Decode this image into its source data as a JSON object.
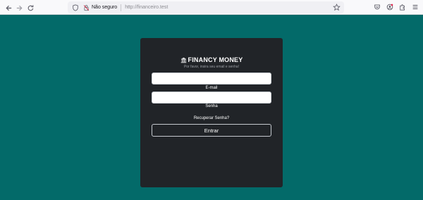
{
  "browser": {
    "security_label": "Não seguro",
    "url": "http://financeiro.test",
    "icons": [
      "back-icon",
      "forward-icon",
      "reload-icon",
      "shield-icon",
      "lock-insecure-icon",
      "star-icon",
      "pocket-icon",
      "account-icon",
      "extensions-icon",
      "menu-icon"
    ]
  },
  "login": {
    "brand": "FINANCY MONEY",
    "brand_icon": "bank-icon",
    "subtitle": "Por favor, insira seu email e senha!",
    "email_label": "E-mail",
    "email_value": "",
    "password_label": "Senha",
    "password_value": "",
    "recover_link": "Recuperar Senha?",
    "submit_label": "Entrar"
  },
  "colors": {
    "background": "#036a69",
    "card": "#212428",
    "toolbar": "#f9f9fb"
  }
}
